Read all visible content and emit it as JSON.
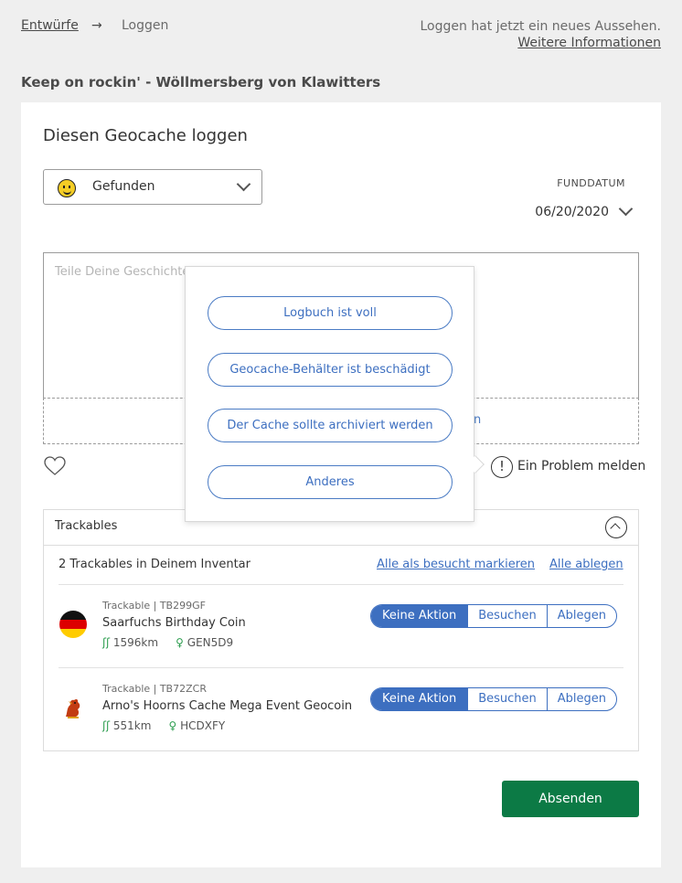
{
  "breadcrumb": {
    "parent": "Entwürfe",
    "separator": "→",
    "current": "Loggen"
  },
  "notice": {
    "text": "Loggen hat jetzt ein neues Aussehen.",
    "link": "Weitere Informationen"
  },
  "cache_title": "Keep on rockin' - Wöllmersberg von Klawitters",
  "form": {
    "heading": "Diesen Geocache loggen",
    "log_type": {
      "selected": "Gefunden",
      "icon": "smiley-icon"
    },
    "date_label": "FUNDDATUM",
    "date_value": "06/20/2020",
    "textarea_placeholder": "Teile Deine Geschichte",
    "dropzone_fragment": "n",
    "favorite_icon": "heart-icon",
    "report_problem": "Ein Problem melden"
  },
  "problem_menu": {
    "options": [
      "Logbuch ist voll",
      "Geocache-Behälter ist beschädigt",
      "Der Cache sollte archiviert werden",
      "Anderes"
    ]
  },
  "trackables": {
    "header": "Trackables",
    "inventory_label": "2 Trackables in Deinem Inventar",
    "mark_all_visited": "Alle als besucht markieren",
    "drop_all": "Alle ablegen",
    "actions": [
      "Keine Aktion",
      "Besuchen",
      "Ablegen"
    ],
    "items": [
      {
        "meta": "Trackable | TB299GF",
        "name": "Saarfuchs Birthday Coin",
        "distance": "1596km",
        "location": "GEN5D9",
        "selected_action": "Keine Aktion"
      },
      {
        "meta": "Trackable | TB72ZCR",
        "name": "Arno's Hoorns Cache Mega Event Geocoin",
        "distance": "551km",
        "location": "HCDXFY",
        "selected_action": "Keine Aktion"
      }
    ]
  },
  "submit_label": "Absenden",
  "colors": {
    "accent": "#3d6fc0",
    "submit": "#0c7a45",
    "background": "#efefef"
  }
}
